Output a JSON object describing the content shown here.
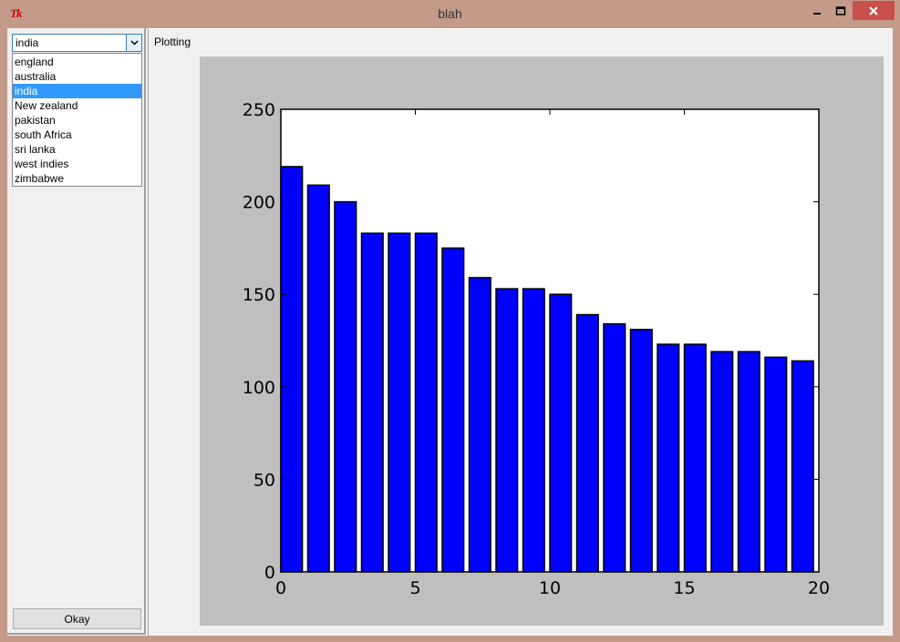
{
  "window": {
    "title": "blah",
    "app_icon_text": "Tk",
    "minimize_symbol": "–",
    "maximize_symbol": "□",
    "close_symbol": "✕"
  },
  "sidebar": {
    "combo_value": "india",
    "list_items": [
      {
        "label": "england"
      },
      {
        "label": "australia"
      },
      {
        "label": "india",
        "selected": true
      },
      {
        "label": "New zealand"
      },
      {
        "label": "pakistan"
      },
      {
        "label": "south Africa"
      },
      {
        "label": "sri lanka"
      },
      {
        "label": "west indies"
      },
      {
        "label": "zimbabwe"
      }
    ],
    "okay_label": "Okay"
  },
  "main": {
    "plot_label": "Plotting"
  },
  "colors": {
    "bar_fill": "#0000ff",
    "figure_bg": "#bfbfbf",
    "selection": "#3399ff",
    "title_bar": "#c49b8a",
    "close_button": "#c7504b"
  },
  "chart_data": {
    "type": "bar",
    "x": [
      0,
      1,
      2,
      3,
      4,
      5,
      6,
      7,
      8,
      9,
      10,
      11,
      12,
      13,
      14,
      15,
      16,
      17,
      18,
      19
    ],
    "values": [
      219,
      209,
      200,
      183,
      183,
      183,
      175,
      159,
      153,
      153,
      150,
      139,
      134,
      131,
      123,
      123,
      119,
      119,
      116,
      114
    ],
    "bar_width": 0.8,
    "xlim": [
      0,
      20
    ],
    "ylim": [
      0,
      250
    ],
    "xticks": [
      "0",
      "5",
      "10",
      "15",
      "20"
    ],
    "yticks": [
      "0",
      "50",
      "100",
      "150",
      "200",
      "250"
    ],
    "title": "",
    "xlabel": "",
    "ylabel": "",
    "grid": false
  }
}
